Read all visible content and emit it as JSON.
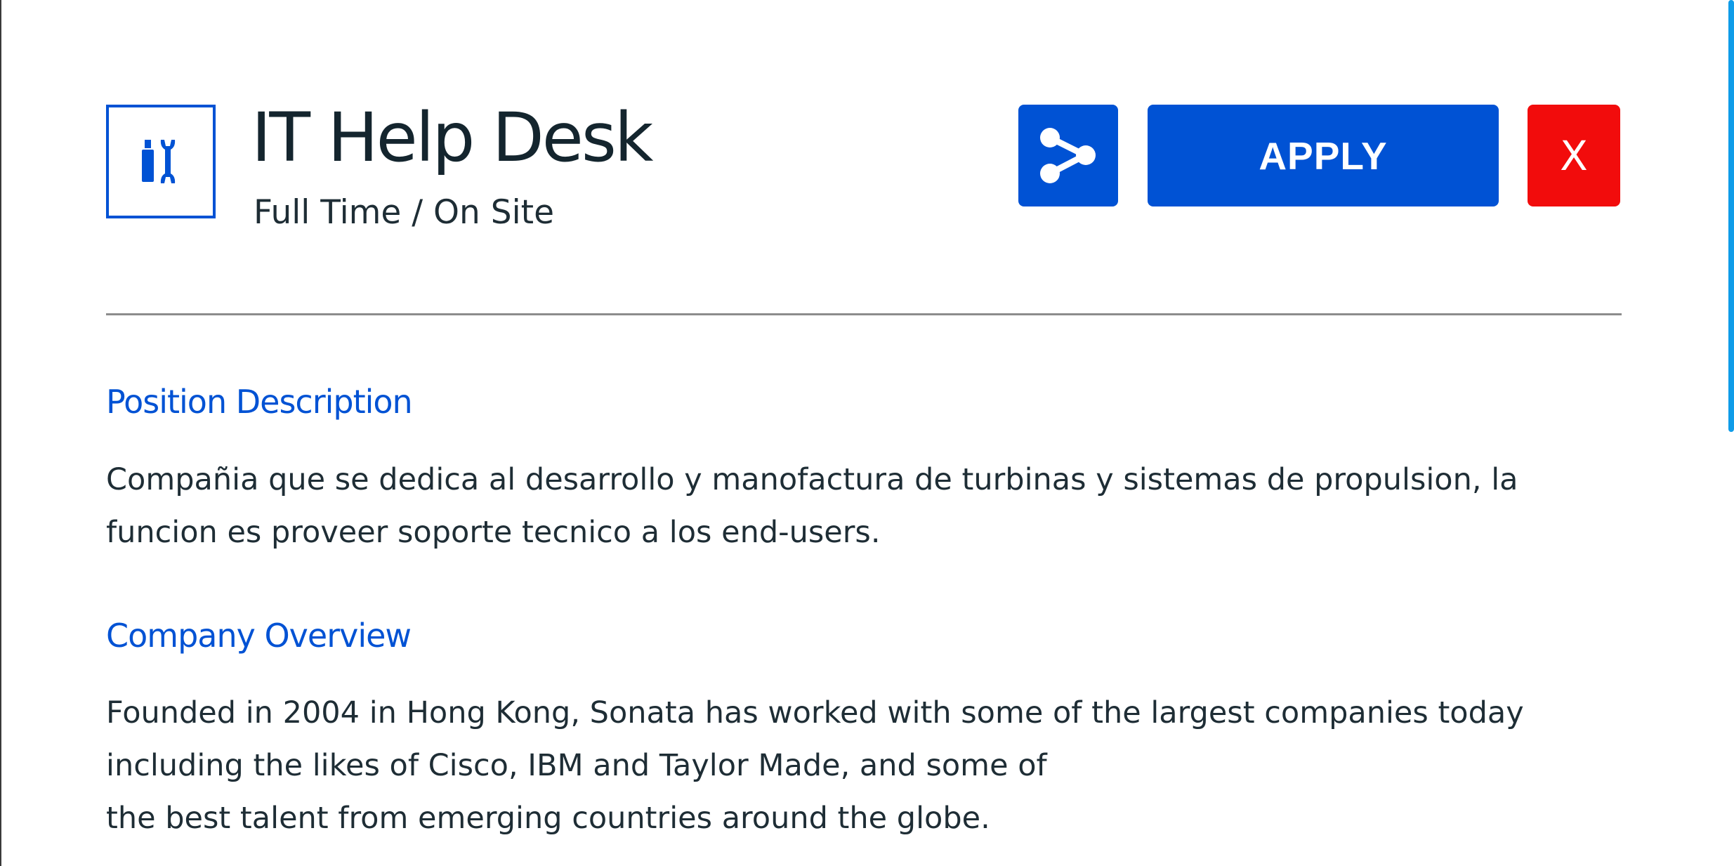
{
  "job": {
    "icon": "tools-icon",
    "title": "IT Help Desk",
    "subtitle": "Full Time / On Site"
  },
  "actions": {
    "share_icon": "share-icon",
    "apply_label": "APPLY",
    "close_label": "X"
  },
  "sections": [
    {
      "heading": "Position Description",
      "lines": [
        "Compañia que se dedica al desarrollo y manofactura de turbinas y sistemas de propulsion, la",
        "funcion es proveer soporte tecnico a los end-users."
      ]
    },
    {
      "heading": "Company Overview",
      "lines": [
        "Founded in 2004 in Hong Kong, Sonata has worked with some of the largest companies today",
        "including the likes of Cisco, IBM and Taylor Made, and some of",
        "the best talent from emerging countries around the globe."
      ]
    }
  ],
  "colors": {
    "accent": "#0052d4",
    "close": "#f20c0c",
    "scrollbar": "#0f9ce8",
    "text": "#1e2d35"
  }
}
